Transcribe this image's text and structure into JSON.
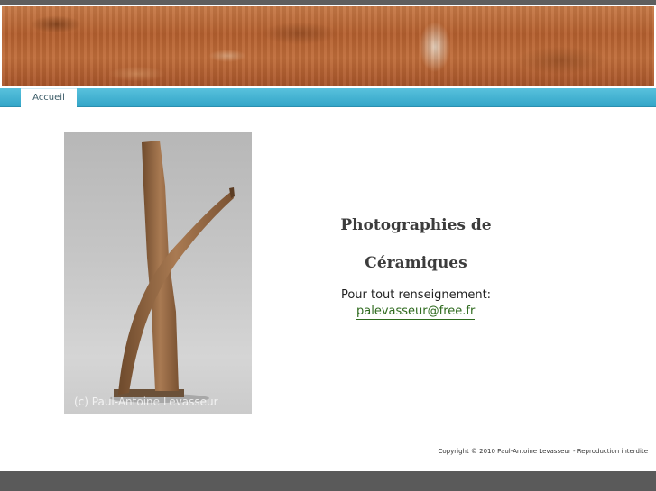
{
  "nav": {
    "tabs": [
      {
        "label": "Accueil"
      }
    ]
  },
  "main": {
    "title_line1": "Photographies de",
    "title_line2": "Céramiques",
    "contact_label": "Pour tout renseignement:",
    "contact_email": "palevasseur@free.fr"
  },
  "photo": {
    "watermark": "(c) Paul-Antoine Levasseur"
  },
  "footer": {
    "copyright": "Copyright © 2010 Paul-Antoine Levasseur - Reproduction interdite"
  },
  "colors": {
    "nav_bar": "#3eb0d0",
    "link": "#2e6a1e",
    "top_bar": "#5e5e5e"
  }
}
